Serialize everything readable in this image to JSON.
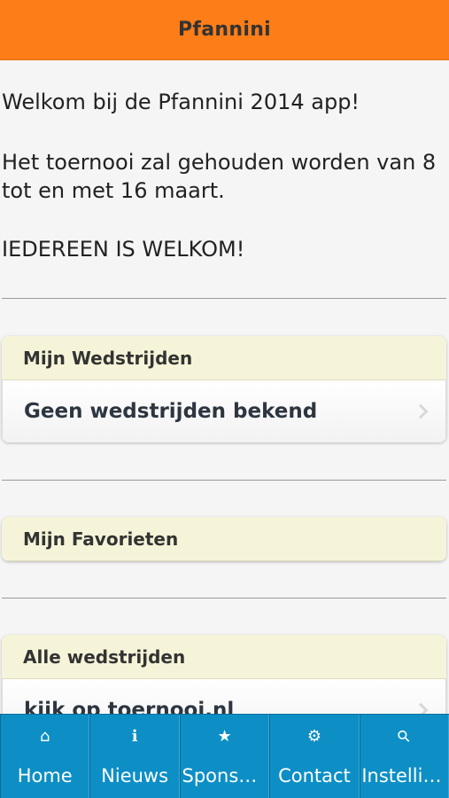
{
  "header": {
    "title": "Pfannini"
  },
  "intro": {
    "welcome": "Welkom bij de Pfannini 2014 app!",
    "info": "Het toernooi zal gehouden worden van 8 tot en met 16 maart.",
    "everyone": "IEDEREEN IS WELKOM!"
  },
  "sections": {
    "my_matches": {
      "title": "Mijn Wedstrijden",
      "row": "Geen wedstrijden bekend"
    },
    "favorites": {
      "title": "Mijn Favorieten"
    },
    "all_matches": {
      "title": "Alle wedstrijden",
      "row": "kijk op toernooi.nl"
    }
  },
  "tabs": [
    {
      "label": "Home",
      "icon": "home-icon",
      "glyph": "⌂"
    },
    {
      "label": "Nieuws",
      "icon": "info-icon",
      "glyph": "i"
    },
    {
      "label": "Sponsoren",
      "icon": "star-icon",
      "glyph": "★"
    },
    {
      "label": "Contact",
      "icon": "gear-icon",
      "glyph": "⚙"
    },
    {
      "label": "Instellingen",
      "icon": "search-icon",
      "glyph": "⚲"
    }
  ],
  "colors": {
    "header": "#fd7d18",
    "tabbar": "#0d8fc6",
    "panel_head": "#f6f4d8"
  }
}
